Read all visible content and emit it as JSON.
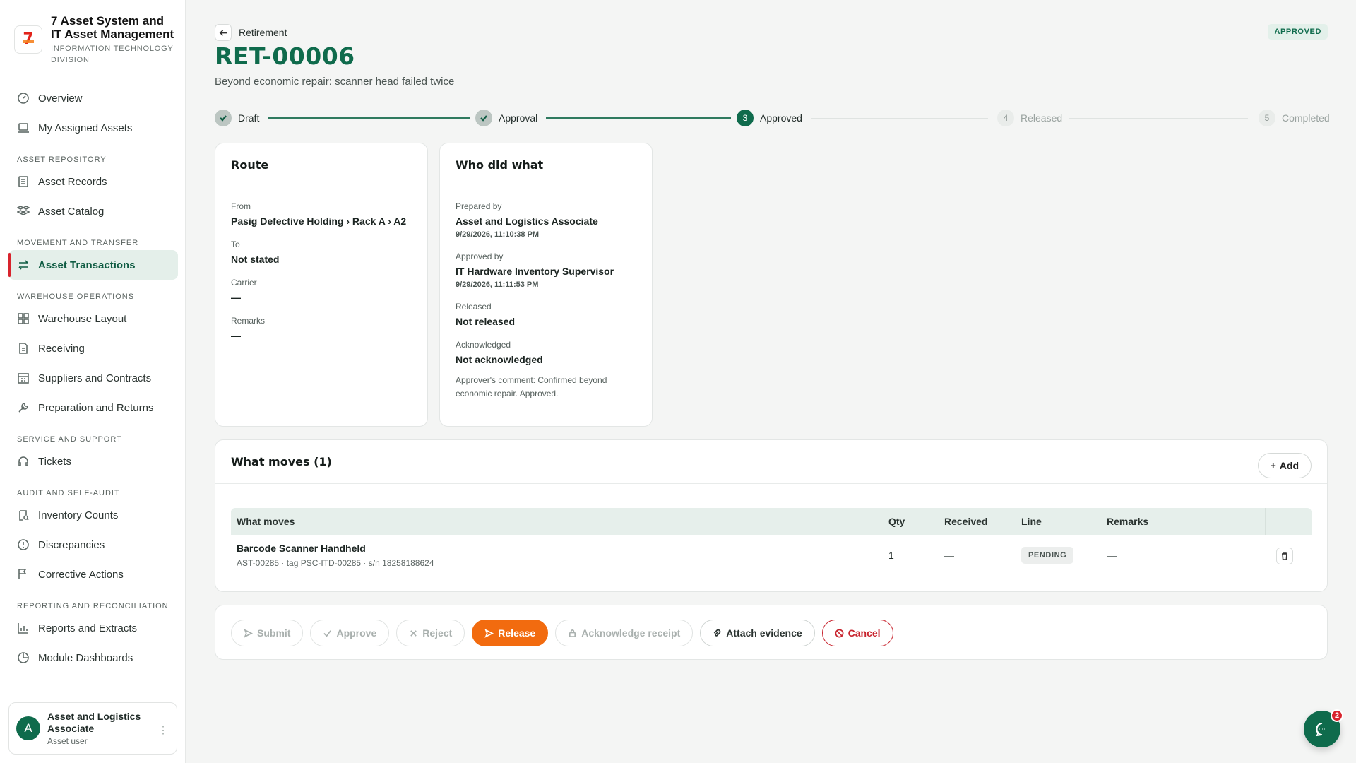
{
  "brand": {
    "title": "7 Asset System and IT Asset Management",
    "subtitle": "INFORMATION TECHNOLOGY DIVISION",
    "logo_text": "7"
  },
  "sidebar": {
    "top_items": [
      {
        "label": "Overview",
        "icon": "gauge-icon"
      },
      {
        "label": "My Assigned Assets",
        "icon": "laptop-icon"
      }
    ],
    "sections": [
      {
        "title": "ASSET REPOSITORY",
        "items": [
          {
            "label": "Asset Records",
            "icon": "list-icon"
          },
          {
            "label": "Asset Catalog",
            "icon": "boxes-icon"
          }
        ]
      },
      {
        "title": "MOVEMENT AND TRANSFER",
        "items": [
          {
            "label": "Asset Transactions",
            "icon": "arrows-swap-icon",
            "active": true
          }
        ]
      },
      {
        "title": "WAREHOUSE OPERATIONS",
        "items": [
          {
            "label": "Warehouse Layout",
            "icon": "grid-icon"
          },
          {
            "label": "Receiving",
            "icon": "document-icon"
          },
          {
            "label": "Suppliers and Contracts",
            "icon": "building-icon"
          },
          {
            "label": "Preparation and Returns",
            "icon": "wrench-icon"
          }
        ]
      },
      {
        "title": "SERVICE AND SUPPORT",
        "items": [
          {
            "label": "Tickets",
            "icon": "headset-icon"
          }
        ]
      },
      {
        "title": "AUDIT AND SELF-AUDIT",
        "items": [
          {
            "label": "Inventory Counts",
            "icon": "clipboard-search-icon"
          },
          {
            "label": "Discrepancies",
            "icon": "alert-circle-icon"
          },
          {
            "label": "Corrective Actions",
            "icon": "flag-icon"
          }
        ]
      },
      {
        "title": "REPORTING AND RECONCILIATION",
        "items": [
          {
            "label": "Reports and Extracts",
            "icon": "bar-chart-icon"
          },
          {
            "label": "Module Dashboards",
            "icon": "pie-chart-icon"
          }
        ]
      }
    ]
  },
  "user": {
    "initial": "A",
    "name": "Asset and Logistics Associate",
    "role": "Asset user"
  },
  "header": {
    "breadcrumb": "Retirement",
    "title": "RET-00006",
    "subtitle": "Beyond economic repair: scanner head failed twice",
    "status": "APPROVED"
  },
  "stepper": [
    {
      "num": "1",
      "label": "Draft",
      "state": "done"
    },
    {
      "num": "2",
      "label": "Approval",
      "state": "done"
    },
    {
      "num": "3",
      "label": "Approved",
      "state": "current"
    },
    {
      "num": "4",
      "label": "Released",
      "state": "todo"
    },
    {
      "num": "5",
      "label": "Completed",
      "state": "todo"
    }
  ],
  "route": {
    "title": "Route",
    "from_label": "From",
    "from_value": "Pasig Defective Holding › Rack A › A2",
    "to_label": "To",
    "to_value": "Not stated",
    "carrier_label": "Carrier",
    "carrier_value": "—",
    "remarks_label": "Remarks",
    "remarks_value": "—"
  },
  "who": {
    "title": "Who did what",
    "prepared_label": "Prepared by",
    "prepared_value": "Asset and Logistics Associate",
    "prepared_time": "9/29/2026, 11:10:38 PM",
    "approved_label": "Approved by",
    "approved_value": "IT Hardware Inventory Supervisor",
    "approved_time": "9/29/2026, 11:11:53 PM",
    "released_label": "Released",
    "released_value": "Not released",
    "ack_label": "Acknowledged",
    "ack_value": "Not acknowledged",
    "comment": "Approver's comment: Confirmed beyond economic repair. Approved."
  },
  "moves": {
    "title": "What moves (1)",
    "add_label": "Add",
    "columns": [
      "What moves",
      "Qty",
      "Received",
      "Line",
      "Remarks"
    ],
    "rows": [
      {
        "name": "Barcode Scanner Handheld",
        "meta": "AST-00285 · tag PSC-ITD-00285 · s/n 18258188624",
        "qty": "1",
        "received": "—",
        "line": "PENDING",
        "remarks": "—"
      }
    ]
  },
  "actions": {
    "submit": "Submit",
    "approve": "Approve",
    "reject": "Reject",
    "release": "Release",
    "acknowledge": "Acknowledge receipt",
    "evidence": "Attach evidence",
    "cancel": "Cancel"
  },
  "chat": {
    "badge": "2"
  },
  "colors": {
    "brand_green": "#0f6b4c",
    "release_orange": "#f26b0f",
    "cancel_red": "#c8242e"
  }
}
